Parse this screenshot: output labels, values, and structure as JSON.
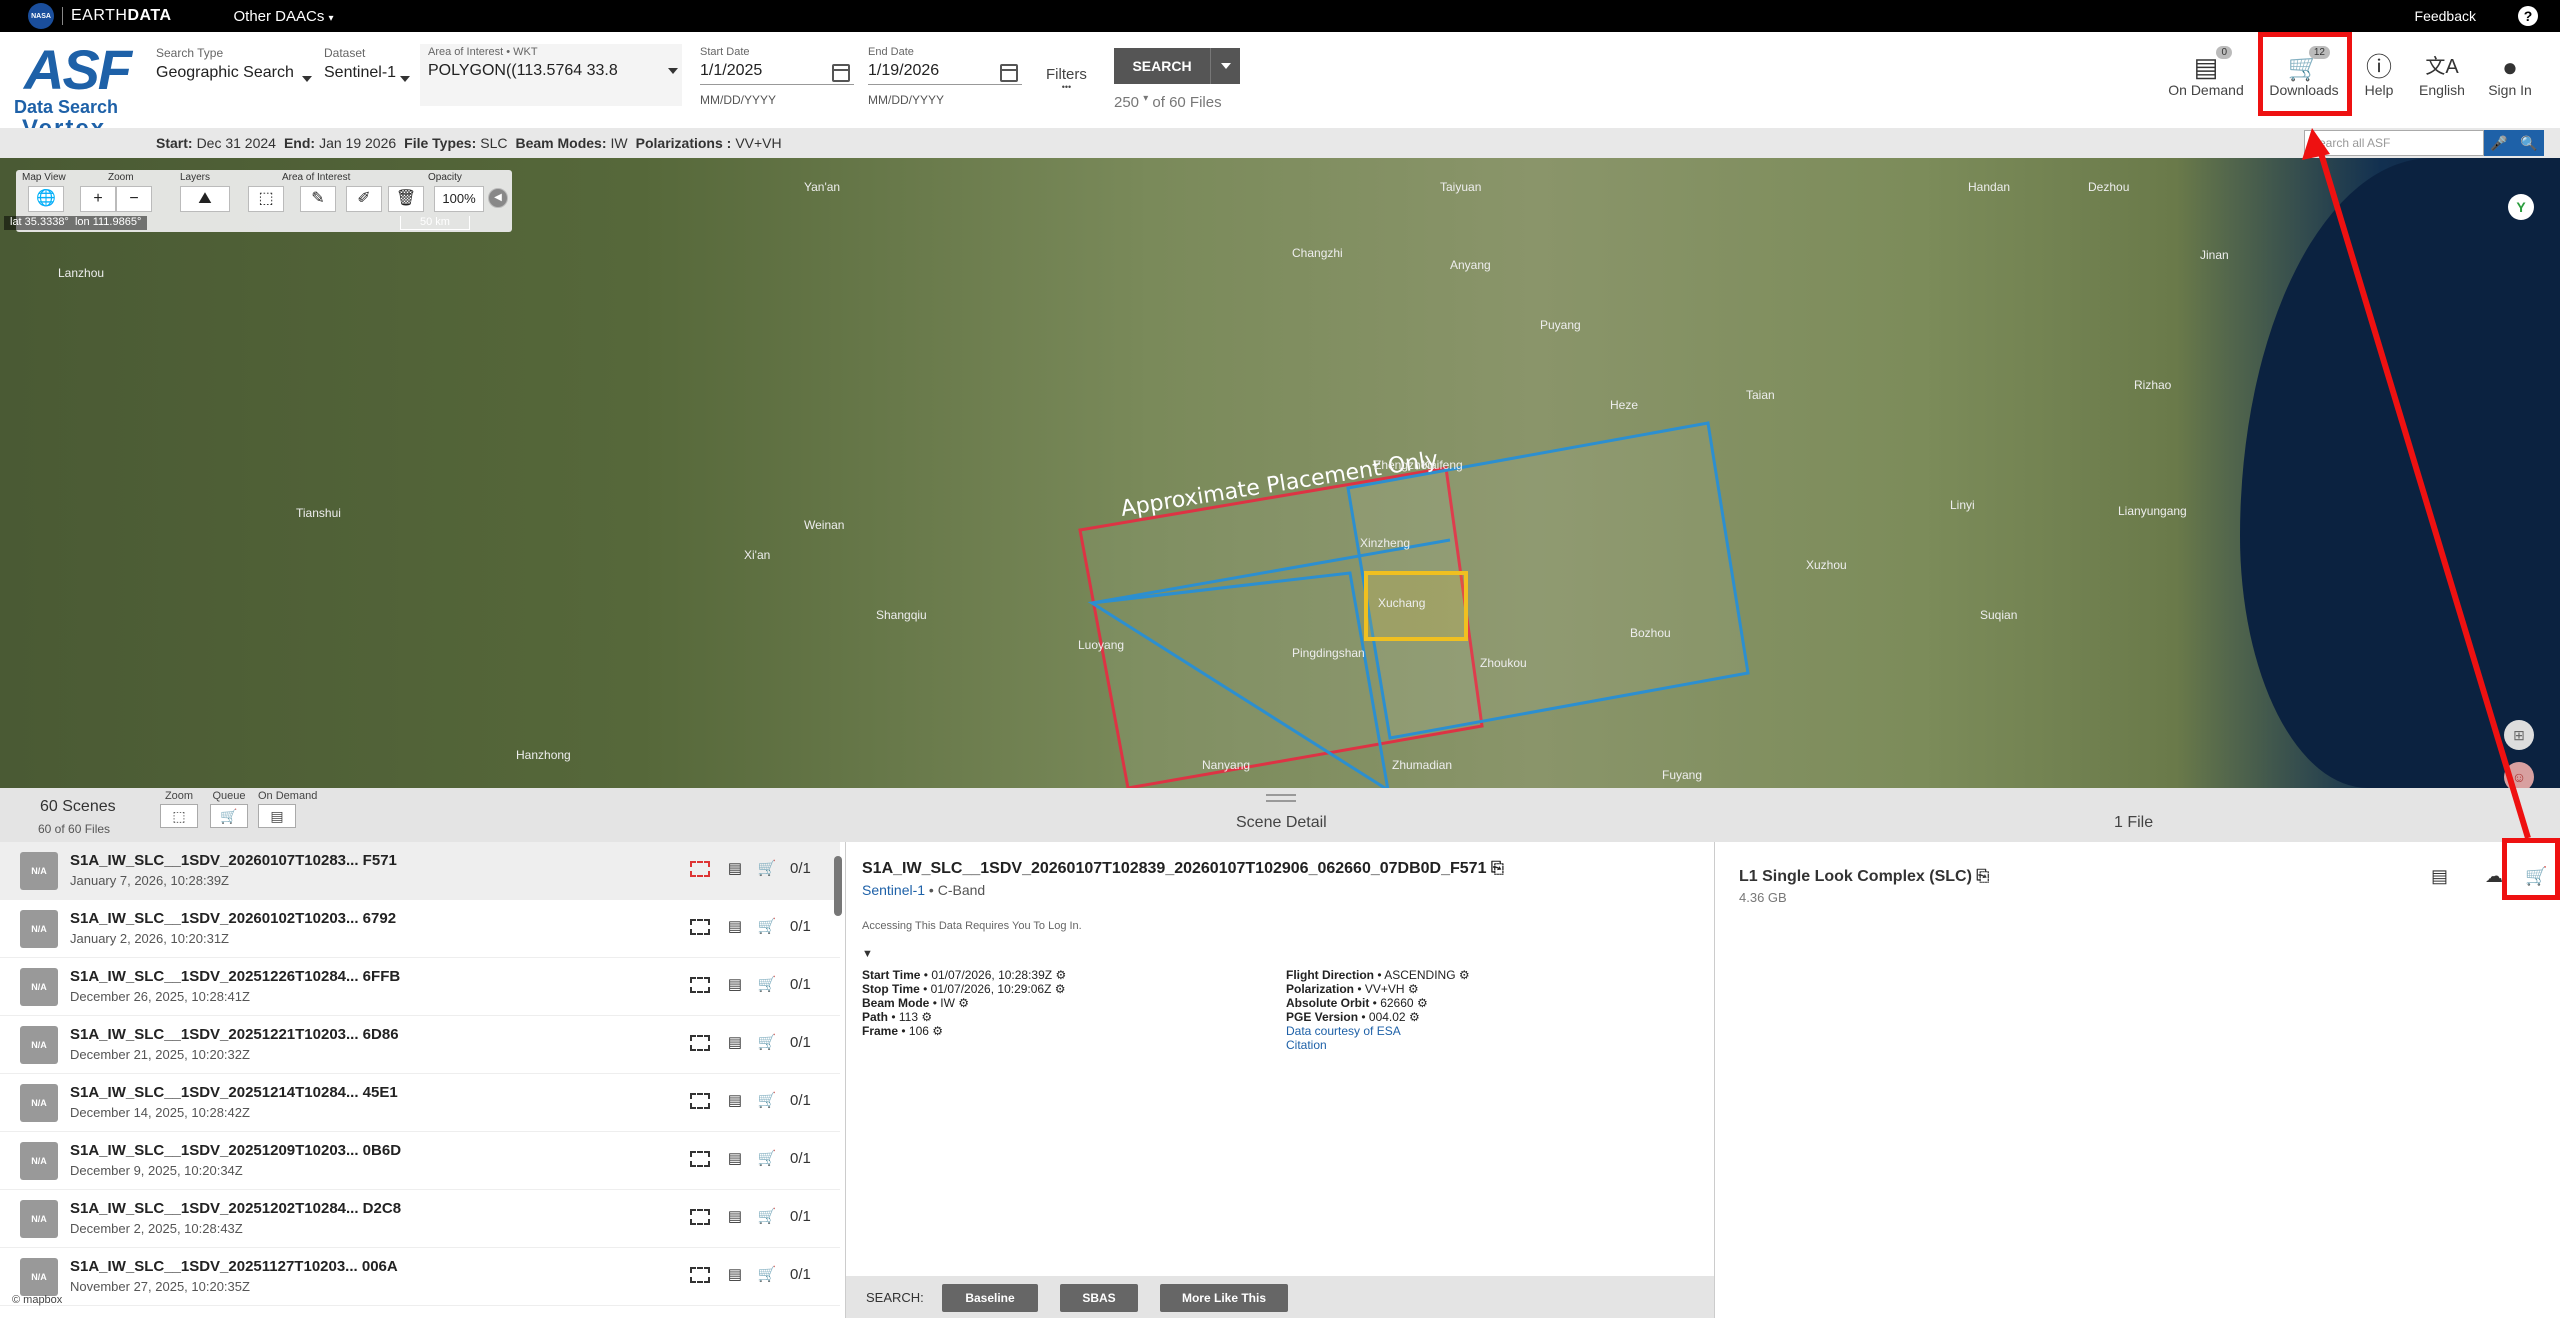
{
  "topbar": {
    "nasa": "NASA",
    "earthdata_prefix": "EARTH",
    "earthdata_suffix": "DATA",
    "other_daacs": "Other DAACs",
    "daacs_caret": "▾",
    "feedback": "Feedback",
    "help": "?"
  },
  "logo": {
    "asf": "ASF",
    "data_search": "Data Search",
    "vertex": "Vertex"
  },
  "search_form": {
    "search_type_label": "Search Type",
    "search_type_value": "Geographic Search",
    "dataset_label": "Dataset",
    "dataset_value": "Sentinel-1",
    "aoi_label": "Area of Interest • WKT",
    "aoi_value": "POLYGON((113.5764 33.8",
    "start_label": "Start Date",
    "start_value": "1/1/2025",
    "start_hint": "MM/DD/YYYY",
    "end_label": "End Date",
    "end_value": "1/19/2026",
    "end_hint": "MM/DD/YYYY",
    "filters_label": "Filters",
    "filters_dots": "•••",
    "search_button": "SEARCH",
    "max_results": "250",
    "max_results_caret": "▾",
    "of_files": "of 60 Files"
  },
  "header_actions": [
    {
      "label": "On Demand",
      "icon": "on-demand-icon",
      "glyph": "▤",
      "badge": "0"
    },
    {
      "label": "Downloads",
      "icon": "cart-icon",
      "glyph": "🛒",
      "badge": "12"
    },
    {
      "label": "Help",
      "icon": "help-circle-icon",
      "glyph": "ⓘ",
      "badge": ""
    },
    {
      "label": "English",
      "icon": "translate-icon",
      "glyph": "文A",
      "badge": ""
    },
    {
      "label": "Sign In",
      "icon": "account-icon",
      "glyph": "●",
      "badge": ""
    }
  ],
  "subbar": {
    "start_label": "Start:",
    "start_value": "Dec 31 2024",
    "end_label": "End:",
    "end_value": "Jan 19 2026",
    "types_label": "File Types:",
    "types_value": "SLC",
    "beam_label": "Beam Modes:",
    "beam_value": "IW",
    "pol_label": "Polarizations :",
    "pol_value": "VV+VH",
    "asf_search_placeholder": "Search all ASF",
    "mic_glyph": "🎤",
    "search_glyph": "🔍"
  },
  "map": {
    "tools": {
      "map_view": "Map View",
      "zoom": "Zoom",
      "layers": "Layers",
      "aoi": "Area of Interest",
      "opacity": "Opacity",
      "opacity_value": "100%",
      "globe_glyph": "🌐",
      "zoom_in_glyph": "+",
      "zoom_out_glyph": "−",
      "layers_glyph": "⛰",
      "aoi_box_glyph": "⬚",
      "draw_glyph": "✎",
      "edit_glyph": "✐",
      "delete_glyph": "🗑",
      "collapse_glyph": "◀"
    },
    "lat": "lat 35.3338°",
    "lon": "lon 111.9865°",
    "scale": "50 km",
    "placement_note": "Approximate Placement Only",
    "side_y_glyph": "Y",
    "side_add_glyph": "⊞",
    "side_user_glyph": "☺",
    "cities": [
      {
        "name": "Lanzhou"
      },
      {
        "name": "Yan'an"
      },
      {
        "name": "Taiyuan"
      },
      {
        "name": "Handan"
      },
      {
        "name": "Dezhou"
      },
      {
        "name": "Jinan"
      },
      {
        "name": "Changzhi"
      },
      {
        "name": "Anyang"
      },
      {
        "name": "Puyang"
      },
      {
        "name": "Heze"
      },
      {
        "name": "Xi'an"
      },
      {
        "name": "Weinan"
      },
      {
        "name": "Zhengzhou"
      },
      {
        "name": "Kaifeng"
      },
      {
        "name": "Xinzheng"
      },
      {
        "name": "Xuchang"
      },
      {
        "name": "Shangqiu"
      },
      {
        "name": "Luoyang"
      },
      {
        "name": "Pingdingshan"
      },
      {
        "name": "Zhoukou"
      },
      {
        "name": "Bozhou"
      },
      {
        "name": "Xuzhou"
      },
      {
        "name": "Suqian"
      },
      {
        "name": "Nanyang"
      },
      {
        "name": "Zhumadian"
      },
      {
        "name": "Fuyang"
      },
      {
        "name": "Hanzhong"
      },
      {
        "name": "Tianshui"
      },
      {
        "name": "Linyi"
      },
      {
        "name": "Lianyungang"
      },
      {
        "name": "Taian"
      },
      {
        "name": "Rizhao"
      }
    ]
  },
  "results": {
    "scenes_count": "60 Scenes",
    "scenes_sub": "60 of 60 Files",
    "tool_zoom": "Zoom",
    "tool_queue": "Queue",
    "tool_on_demand": "On Demand",
    "tool_zoom_glyph": "⬚",
    "tool_queue_glyph": "🛒",
    "tool_on_demand_glyph": "▤",
    "detail_title": "Scene Detail",
    "files_title": "1 File",
    "scenes": [
      {
        "name": "S1A_IW_SLC__1SDV_20260107T10283... F571",
        "date": "January 7, 2026, 10:28:39Z",
        "ratio": "0/1"
      },
      {
        "name": "S1A_IW_SLC__1SDV_20260102T10203... 6792",
        "date": "January 2, 2026, 10:20:31Z",
        "ratio": "0/1"
      },
      {
        "name": "S1A_IW_SLC__1SDV_20251226T10284... 6FFB",
        "date": "December 26, 2025, 10:28:41Z",
        "ratio": "0/1"
      },
      {
        "name": "S1A_IW_SLC__1SDV_20251221T10203... 6D86",
        "date": "December 21, 2025, 10:20:32Z",
        "ratio": "0/1"
      },
      {
        "name": "S1A_IW_SLC__1SDV_20251214T10284... 45E1",
        "date": "December 14, 2025, 10:28:42Z",
        "ratio": "0/1"
      },
      {
        "name": "S1A_IW_SLC__1SDV_20251209T10203... 0B6D",
        "date": "December 9, 2025, 10:20:34Z",
        "ratio": "0/1"
      },
      {
        "name": "S1A_IW_SLC__1SDV_20251202T10284... D2C8",
        "date": "December 2, 2025, 10:28:43Z",
        "ratio": "0/1"
      },
      {
        "name": "S1A_IW_SLC__1SDV_20251127T10203... 006A",
        "date": "November 27, 2025, 10:20:35Z",
        "ratio": "0/1"
      }
    ],
    "thumb_label": "N/A",
    "row_zoom_glyph": "",
    "row_ondemand_glyph": "▤",
    "row_cart_glyph": "🛒"
  },
  "detail": {
    "title": "S1A_IW_SLC__1SDV_20260107T102839_20260107T102906_062660_07DB0D_F571",
    "copy_glyph": "⎘",
    "platform": "Sentinel-1",
    "band": " • C-Band",
    "login_note": "Accessing This Data Requires You To Log In.",
    "expand_glyph": "▼",
    "left_meta": [
      {
        "k": "Start Time",
        "v": " • 01/07/2026, 10:28:39Z"
      },
      {
        "k": "Stop Time",
        "v": " • 01/07/2026, 10:29:06Z"
      },
      {
        "k": "Beam Mode",
        "v": " • IW"
      },
      {
        "k": "Path",
        "v": " • 113"
      },
      {
        "k": "Frame",
        "v": " • 106"
      }
    ],
    "right_meta": [
      {
        "k": "Flight Direction",
        "v": " • ASCENDING"
      },
      {
        "k": "Polarization",
        "v": " • VV+VH"
      },
      {
        "k": "Absolute Orbit",
        "v": " • 62660"
      },
      {
        "k": "PGE Version",
        "v": " • 004.02"
      }
    ],
    "gear_glyph": "⚙",
    "courtesy_link": "Data courtesy of ESA",
    "citation_link": "Citation",
    "search_label": "SEARCH:",
    "baseline_button": "Baseline",
    "sbas_button": "SBAS",
    "more_like_button": "More Like This"
  },
  "files": {
    "name": "L1 Single Look Complex (SLC)",
    "size": "4.36 GB",
    "copy_glyph": "⎘",
    "ondemand_glyph": "▤",
    "download_glyph": "☁",
    "addcart_glyph": "🛒"
  },
  "mapbox": "© mapbox",
  "colors": {
    "accent": "#1e61a8",
    "annotation": "#ee1111",
    "footprint_red": "#dd3344",
    "footprint_blue": "#2c8fd0",
    "aoi_yellow": "#f0c020"
  }
}
